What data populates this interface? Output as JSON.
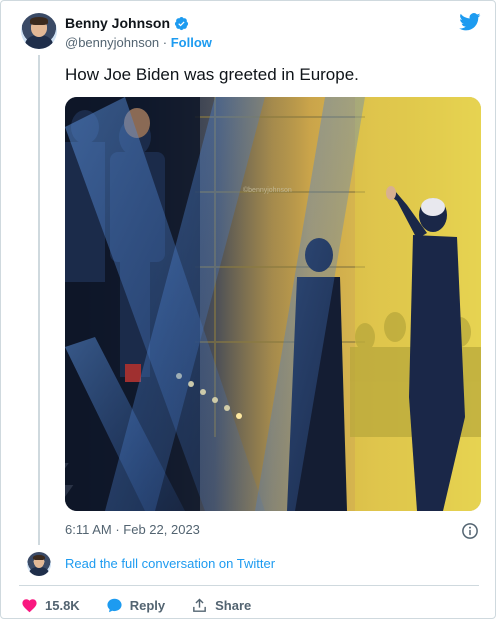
{
  "author": {
    "name": "Benny Johnson",
    "handle": "@bennyjohnson",
    "separator": " · ",
    "follow_label": "Follow",
    "verified": true
  },
  "tweet": {
    "text": "How Joe Biden was greeted in Europe.",
    "photo_watermark": "©bennyjohnson",
    "timestamp": "6:11 AM · Feb 22, 2023"
  },
  "conversation_link": "Read the full conversation on Twitter",
  "actions": {
    "likes": "15.8K",
    "reply_label": "Reply",
    "share_label": "Share"
  },
  "icons": {
    "brand": "twitter-bird-icon",
    "verified": "verified-badge-icon",
    "info": "info-icon",
    "like": "heart-icon",
    "reply": "speech-bubble-icon",
    "share": "share-upload-icon"
  },
  "colors": {
    "accent": "#1d9bf0",
    "like": "#f91880",
    "text": "#0f1419",
    "muted": "#536471",
    "border": "#cfd9de"
  }
}
